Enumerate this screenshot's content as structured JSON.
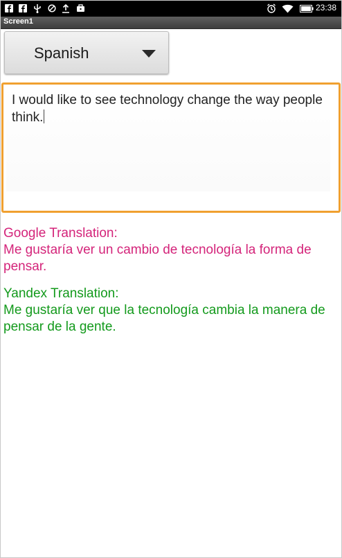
{
  "status_bar": {
    "time": "23:38",
    "left_icons": [
      "facebook-icon",
      "facebook-icon",
      "usb-icon",
      "blocked-icon",
      "upload-icon",
      "briefcase-icon"
    ],
    "right_icons": [
      "alarm-icon",
      "wifi-icon",
      "battery-icon"
    ]
  },
  "title_bar": {
    "title": "Screen1"
  },
  "spinner": {
    "selected": "Spanish"
  },
  "input": {
    "text": "I would like to see technology change the way people think."
  },
  "google": {
    "label": "Google Translation:",
    "text": "Me gustaría ver un cambio de tecnología la forma de pensar.",
    "color": "#d4247a"
  },
  "yandex": {
    "label": "Yandex Translation:",
    "text": "Me gustaría ver que la tecnología cambia la manera de pensar de la gente.",
    "color": "#139a1c"
  },
  "colors": {
    "focus_border": "#f0a030",
    "status_bar": "#000000"
  }
}
